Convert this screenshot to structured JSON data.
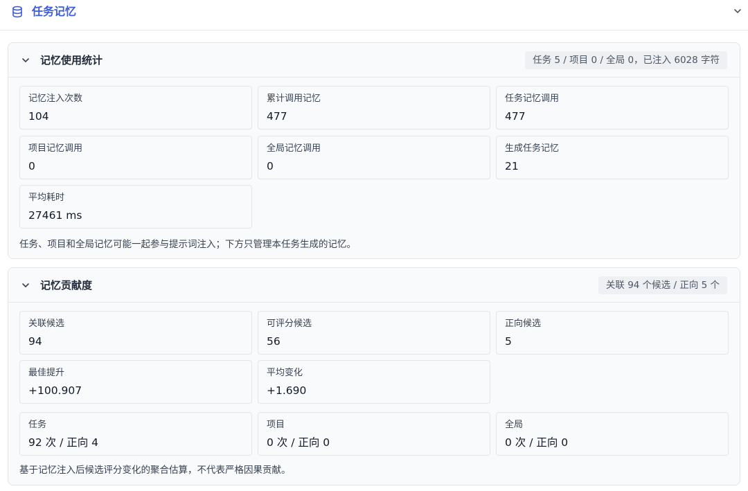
{
  "header": {
    "title": "任务记忆",
    "icon": "database-icon",
    "toggle_icon": "chevron-down-icon"
  },
  "usage": {
    "title": "记忆使用统计",
    "summary": "任务 5 / 项目 0 / 全局 0，已注入 6028 字符",
    "stats": [
      {
        "label": "记忆注入次数",
        "value": "104"
      },
      {
        "label": "累计调用记忆",
        "value": "477"
      },
      {
        "label": "任务记忆调用",
        "value": "477"
      },
      {
        "label": "项目记忆调用",
        "value": "0"
      },
      {
        "label": "全局记忆调用",
        "value": "0"
      },
      {
        "label": "生成任务记忆",
        "value": "21"
      },
      {
        "label": "平均耗时",
        "value": "27461 ms"
      }
    ],
    "note": "任务、项目和全局记忆可能一起参与提示词注入；下方只管理本任务生成的记忆。"
  },
  "contribution": {
    "title": "记忆贡献度",
    "summary": "关联 94 个候选 / 正向 5 个",
    "stats": [
      {
        "label": "关联候选",
        "value": "94"
      },
      {
        "label": "可评分候选",
        "value": "56"
      },
      {
        "label": "正向候选",
        "value": "5"
      },
      {
        "label": "最佳提升",
        "value": "+100.907"
      },
      {
        "label": "平均变化",
        "value": "+1.690"
      },
      {
        "label": "任务",
        "value": "92 次 / 正向 4"
      },
      {
        "label": "项目",
        "value": "0 次 / 正向 0"
      },
      {
        "label": "全局",
        "value": "0 次 / 正向 0"
      }
    ],
    "note": "基于记忆注入后候选评分变化的聚合估算，不代表严格因果贡献。"
  },
  "colors": {
    "accent": "#3b5bdb",
    "card_border": "#e2e5ea",
    "badge_bg": "#eef0f3"
  }
}
